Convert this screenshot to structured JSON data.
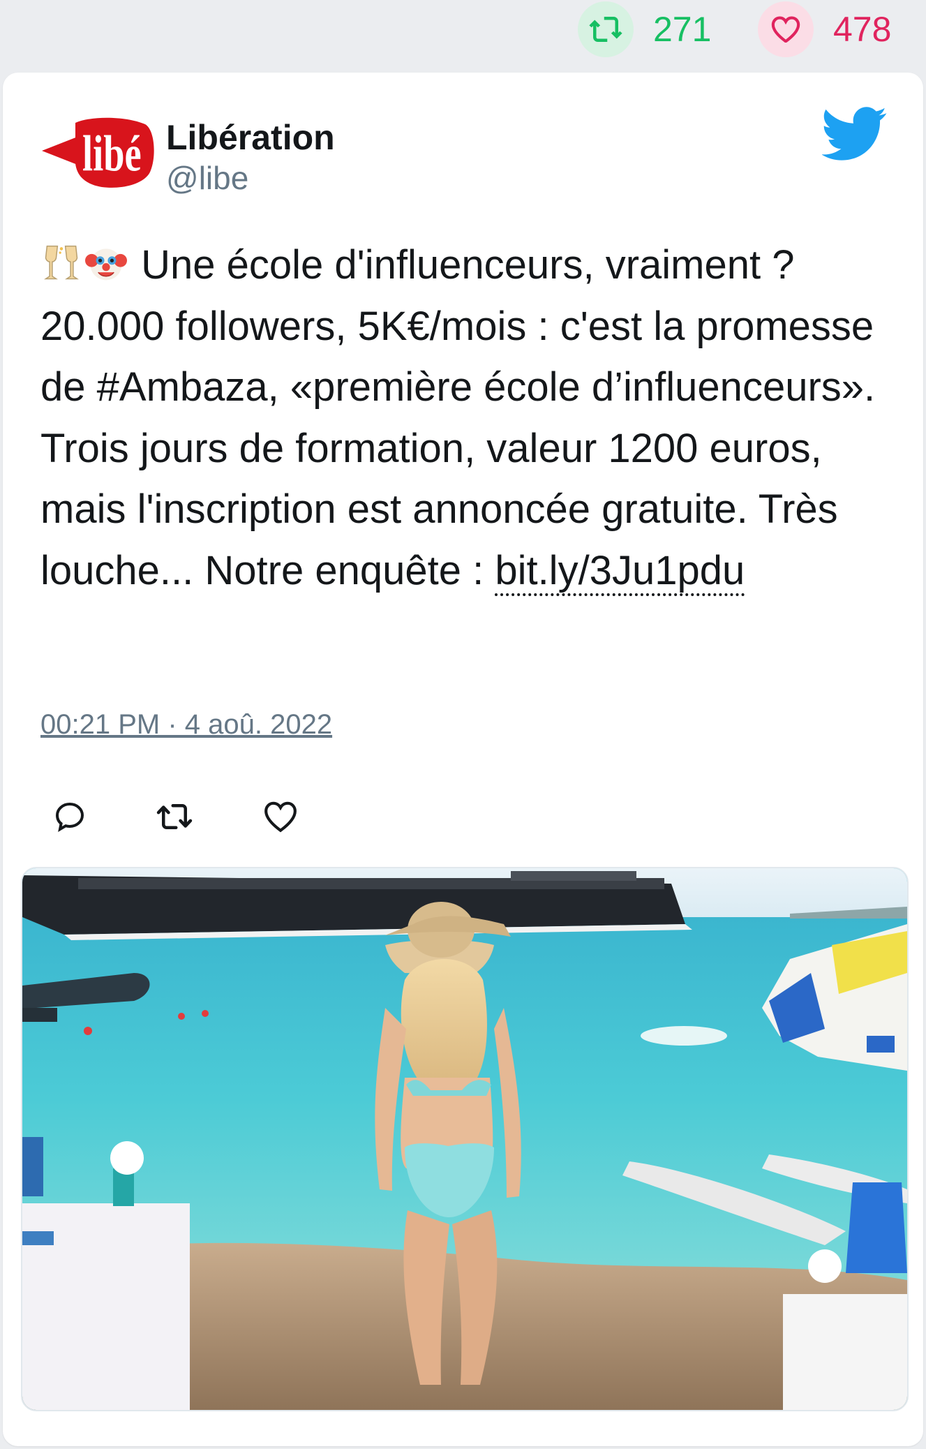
{
  "stats": {
    "retweet_count": "271",
    "like_count": "478",
    "retweet_color": "#17bf63",
    "like_color": "#e0245e"
  },
  "tweet": {
    "author_name": "Libération",
    "author_handle": "@libe",
    "avatar_logo_text": "libé",
    "emojis": [
      "champagne-glasses-icon",
      "clown-face-icon"
    ],
    "text": " Une école d'influenceurs, vraiment ? 20.000 followers, 5K€/mois : c'est la promesse de #Ambaza, «première école d’influenceurs». Trois jours de formation, valeur 1200 euros, mais l'inscription est annoncée gratuite. Très louche... Notre enquête : ",
    "link_text": "bit.ly/3Ju1pdu",
    "timestamp": "00:21 PM · 4 aoû. 2022"
  },
  "actions": {
    "reply_icon": "reply-icon",
    "retweet_icon": "retweet-icon",
    "like_icon": "like-icon"
  },
  "media": {
    "description_icon": "beach-photo"
  },
  "colors": {
    "twitter_blue": "#1da1f2",
    "background": "#ebedf0",
    "card": "#ffffff"
  }
}
